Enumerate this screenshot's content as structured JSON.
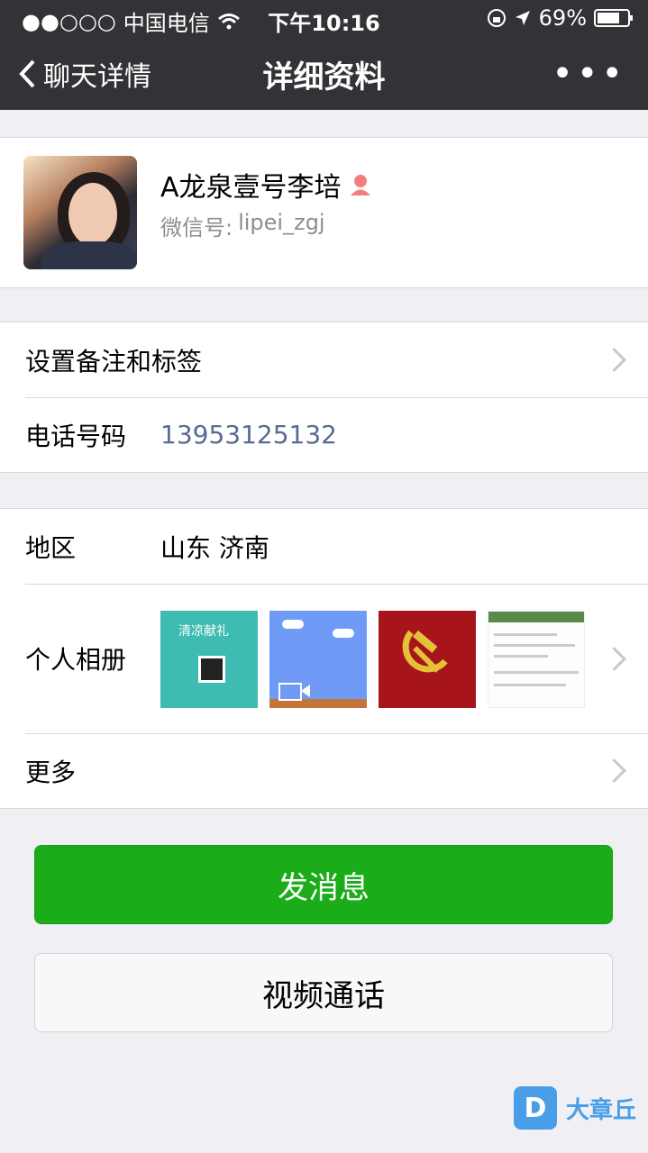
{
  "status_bar": {
    "signal": "●●○○○",
    "carrier": "中国电信",
    "time": "下午10:16",
    "battery": "69%"
  },
  "nav": {
    "back_label": "聊天详情",
    "title": "详细资料",
    "more_label": "•••"
  },
  "profile": {
    "name": "A龙泉壹号李培",
    "wechat_id_label": "微信号:",
    "wechat_id": "lipei_zgj"
  },
  "rows": {
    "remark_label": "设置备注和标签",
    "phone_label": "电话号码",
    "phone_value": "13953125132",
    "region_label": "地区",
    "region_value": "山东 济南",
    "album_label": "个人相册",
    "more_label": "更多"
  },
  "album_thumb_1_text": "清凉献礼",
  "buttons": {
    "message": "发消息",
    "video_call": "视频通话"
  },
  "watermark": {
    "badge": "D",
    "text": "大章丘"
  },
  "colors": {
    "nav_bg": "#333337",
    "accent_green": "#1aad19",
    "phone_link": "#576b95",
    "female_icon": "#f37e7d"
  }
}
